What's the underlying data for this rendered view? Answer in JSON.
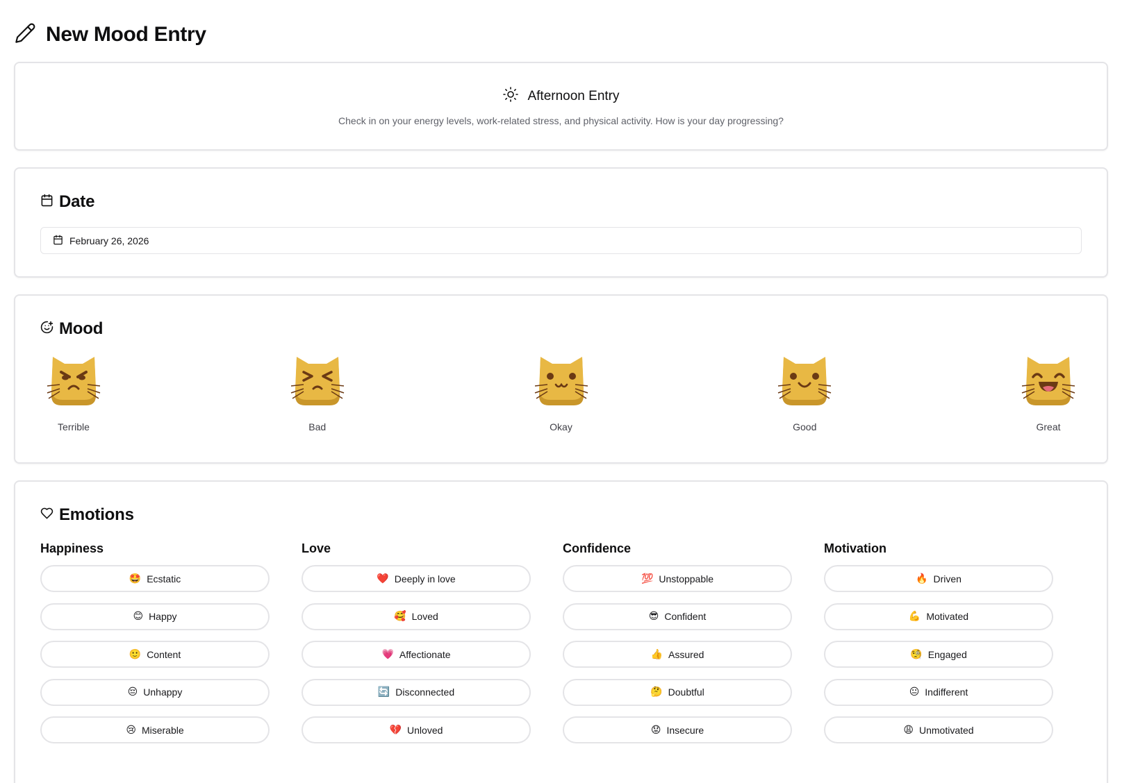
{
  "page": {
    "title": "New Mood Entry",
    "icon": "pencil-icon"
  },
  "intro": {
    "icon": "sun-icon",
    "title": "Afternoon Entry",
    "description": "Check in on your energy levels, work-related stress, and physical activity. How is your day progressing?"
  },
  "date": {
    "title": "Date",
    "icon": "calendar-icon",
    "value": "February 26, 2026"
  },
  "mood": {
    "title": "Mood",
    "icon": "smile-plus-icon",
    "options": [
      {
        "label": "Terrible",
        "icon": "angry-cat-icon"
      },
      {
        "label": "Bad",
        "icon": "squinting-cat-icon"
      },
      {
        "label": "Okay",
        "icon": "neutral-cat-icon"
      },
      {
        "label": "Good",
        "icon": "smiling-cat-icon"
      },
      {
        "label": "Great",
        "icon": "grinning-cat-icon"
      }
    ],
    "colors": {
      "face": "#e8b844",
      "shade": "#c9962a",
      "feature": "#6b3a14"
    }
  },
  "emotions": {
    "title": "Emotions",
    "icon": "heart-icon",
    "categories": [
      {
        "name": "Happiness",
        "items": [
          {
            "emoji": "🤩",
            "label": "Ecstatic"
          },
          {
            "emoji": "😊",
            "label": "Happy"
          },
          {
            "emoji": "🙂",
            "label": "Content"
          },
          {
            "emoji": "😔",
            "label": "Unhappy"
          },
          {
            "emoji": "😢",
            "label": "Miserable"
          }
        ]
      },
      {
        "name": "Love",
        "items": [
          {
            "emoji": "❤️",
            "label": "Deeply in love"
          },
          {
            "emoji": "🥰",
            "label": "Loved"
          },
          {
            "emoji": "💗",
            "label": "Affectionate"
          },
          {
            "emoji": "🔄",
            "label": "Disconnected"
          },
          {
            "emoji": "💔",
            "label": "Unloved"
          }
        ]
      },
      {
        "name": "Confidence",
        "items": [
          {
            "emoji": "💯",
            "label": "Unstoppable"
          },
          {
            "emoji": "😎",
            "label": "Confident"
          },
          {
            "emoji": "👍",
            "label": "Assured"
          },
          {
            "emoji": "🤔",
            "label": "Doubtful"
          },
          {
            "emoji": "😟",
            "label": "Insecure"
          }
        ]
      },
      {
        "name": "Motivation",
        "items": [
          {
            "emoji": "🔥",
            "label": "Driven"
          },
          {
            "emoji": "💪",
            "label": "Motivated"
          },
          {
            "emoji": "🧐",
            "label": "Engaged"
          },
          {
            "emoji": "😐",
            "label": "Indifferent"
          },
          {
            "emoji": "😩",
            "label": "Unmotivated"
          }
        ]
      }
    ]
  }
}
